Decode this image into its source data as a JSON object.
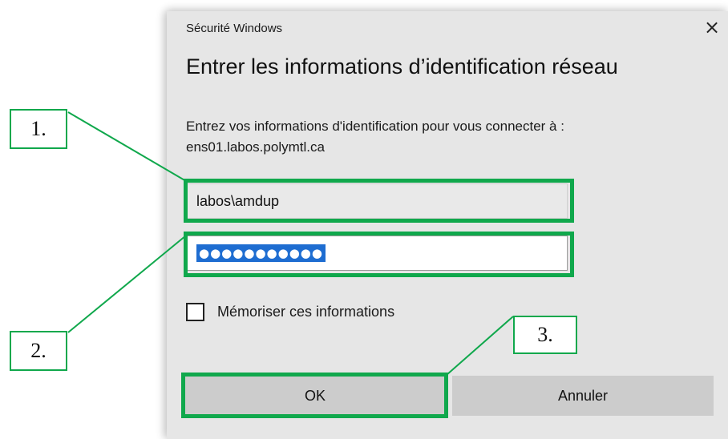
{
  "dialog": {
    "window_title": "Sécurité Windows",
    "close_glyph": "×",
    "heading": "Entrer les informations d’identification réseau",
    "prompt_line1": "Entrez vos informations d'identification pour vous connecter à :",
    "prompt_line2": "ens01.labos.polymtl.ca",
    "username_value": "labos\\amdup",
    "password_masked": "●●●●●●●●●●●",
    "remember_label": "Mémoriser ces informations",
    "remember_checked": false,
    "ok_label": "OK",
    "cancel_label": "Annuler"
  },
  "annotations": {
    "callout_1": "1.",
    "callout_2": "2.",
    "callout_3": "3.",
    "highlight_color": "#10a84c"
  }
}
